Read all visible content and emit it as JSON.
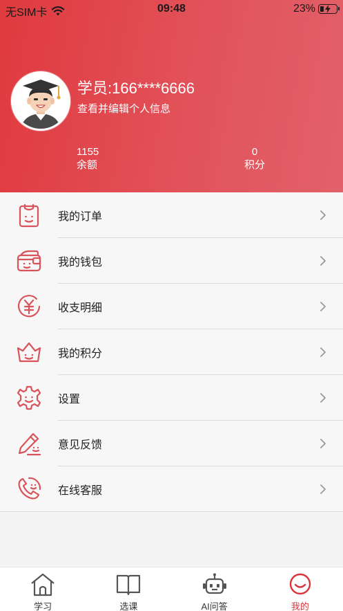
{
  "status_bar": {
    "carrier": "无SIM卡",
    "time": "09:48",
    "battery": "23%",
    "battery_level": 0.23
  },
  "profile": {
    "username": "学员:166****6666",
    "edit_link": "查看并编辑个人信息",
    "balance_value": "1155",
    "balance_label": "余额",
    "points_value": "0",
    "points_label": "积分"
  },
  "menu": {
    "items": [
      {
        "label": "我的订单",
        "icon": "order-icon"
      },
      {
        "label": "我的钱包",
        "icon": "wallet-icon"
      },
      {
        "label": "收支明细",
        "icon": "yuan-icon"
      },
      {
        "label": "我的积分",
        "icon": "crown-icon"
      },
      {
        "label": "设置",
        "icon": "gear-icon"
      },
      {
        "label": "意见反馈",
        "icon": "pencil-icon"
      },
      {
        "label": "在线客服",
        "icon": "phone-icon"
      }
    ]
  },
  "tabbar": {
    "tabs": [
      {
        "label": "学习",
        "icon": "house-icon"
      },
      {
        "label": "选课",
        "icon": "book-icon"
      },
      {
        "label": "AI问答",
        "icon": "robot-icon"
      },
      {
        "label": "我的",
        "icon": "smile-icon",
        "active": true
      }
    ]
  },
  "colors": {
    "accent": "#d9343b",
    "header_start": "#df3a3e",
    "header_end": "#e2616a",
    "icon_stroke": "#d9545a"
  }
}
